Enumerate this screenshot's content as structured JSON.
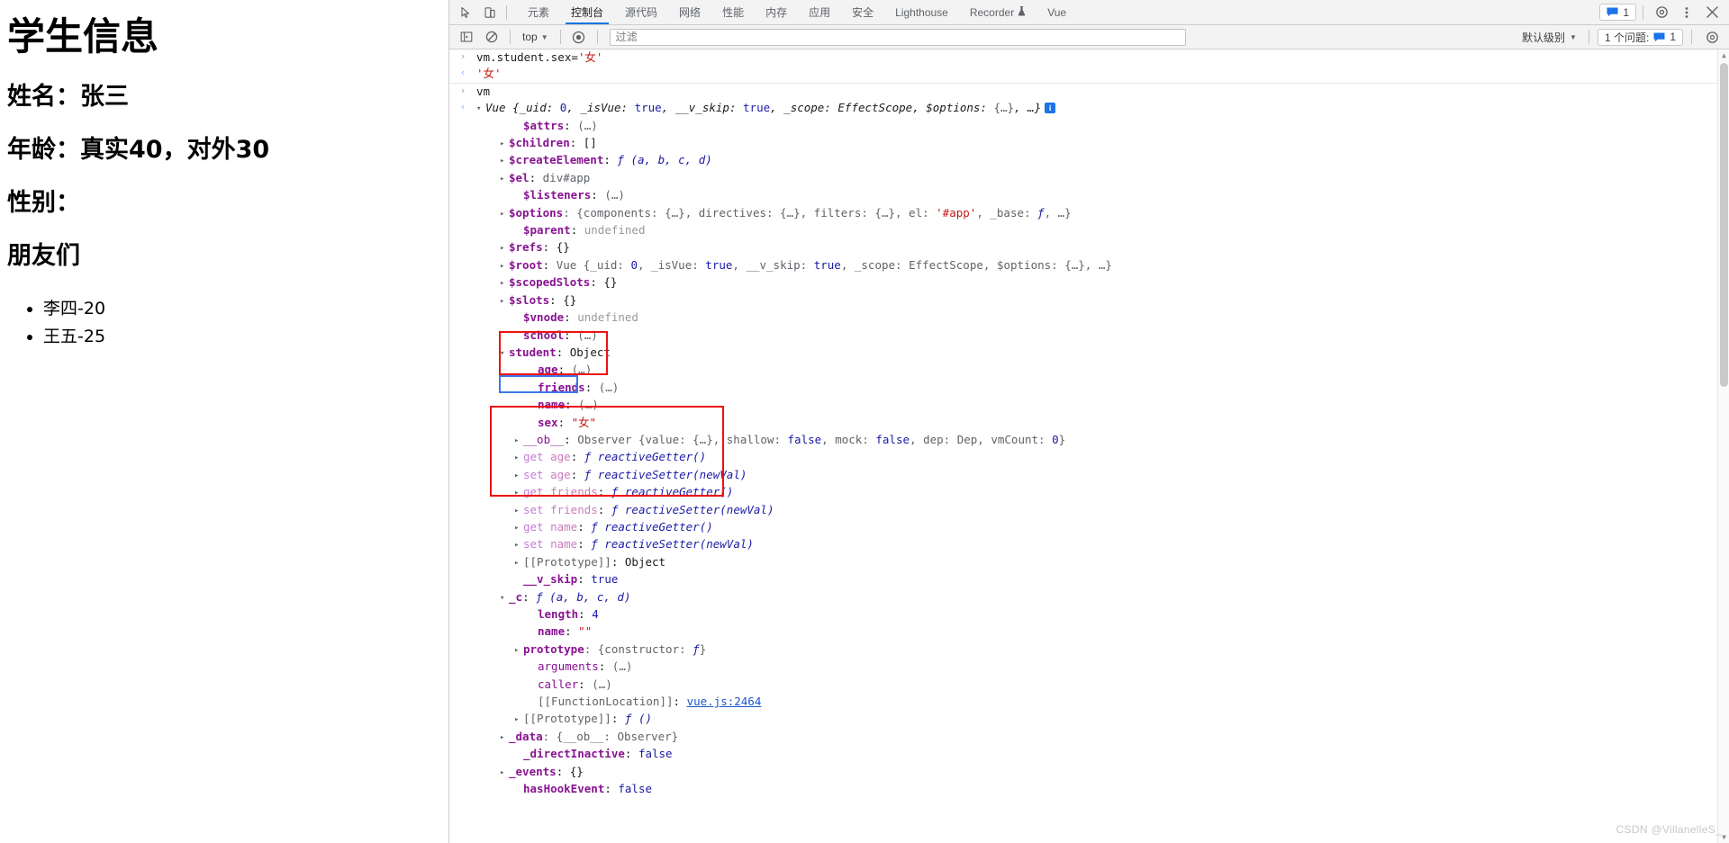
{
  "page": {
    "title": "学生信息",
    "name_line": "姓名：张三",
    "age_line": "年龄：真实40，对外30",
    "sex_line": "性别：",
    "friends_title": "朋友们",
    "friends": [
      "李四-20",
      "王五-25"
    ]
  },
  "devtools": {
    "tabs": [
      {
        "label": "元素",
        "active": false,
        "icon": ""
      },
      {
        "label": "控制台",
        "active": true,
        "icon": ""
      },
      {
        "label": "源代码",
        "active": false,
        "icon": ""
      },
      {
        "label": "网络",
        "active": false,
        "icon": ""
      },
      {
        "label": "性能",
        "active": false,
        "icon": ""
      },
      {
        "label": "内存",
        "active": false,
        "icon": ""
      },
      {
        "label": "应用",
        "active": false,
        "icon": ""
      },
      {
        "label": "安全",
        "active": false,
        "icon": ""
      },
      {
        "label": "Lighthouse",
        "active": false,
        "icon": ""
      },
      {
        "label": "Recorder",
        "active": false,
        "icon": "flask-icon"
      },
      {
        "label": "Vue",
        "active": false,
        "icon": ""
      }
    ],
    "top_right": {
      "messages_count": "1",
      "settings_icon": "gear-icon",
      "more_icon": "kebab-menu-icon",
      "close_icon": "close-icon",
      "inspect_icon": "inspect-element-icon",
      "device_icon": "device-toolbar-icon"
    },
    "console_toolbar": {
      "execute_icon": "sidebar-toggle-icon",
      "clear_icon": "clear-console-icon",
      "context": "top",
      "eye_icon": "live-expression-icon",
      "filter_placeholder": "过滤",
      "filter_value": "",
      "level": "默认级别",
      "issues_label": "1 个问题:",
      "issues_count": "1",
      "settings_icon": "gear-icon"
    }
  },
  "console": {
    "entries": [
      {
        "kind": "input",
        "gutter": "›",
        "indent": 0,
        "segs": [
          {
            "t": "vm.student.sex=",
            "c": "v-obj"
          },
          {
            "t": "'女'",
            "c": "v-str"
          }
        ]
      },
      {
        "kind": "output",
        "gutter": "‹",
        "indent": 0,
        "border": true,
        "segs": [
          {
            "t": "'女'",
            "c": "v-str"
          }
        ]
      },
      {
        "kind": "input",
        "gutter": "›",
        "indent": 0,
        "segs": [
          {
            "t": "vm",
            "c": "v-obj"
          }
        ]
      },
      {
        "kind": "output",
        "gutter": "‹",
        "indent": 0,
        "tri": "▾",
        "segs": [
          {
            "t": "Vue ",
            "c": "v-class"
          },
          {
            "t": "{_uid: ",
            "c": "v-class"
          },
          {
            "t": "0",
            "c": "v-num"
          },
          {
            "t": ", _isVue: ",
            "c": "v-class"
          },
          {
            "t": "true",
            "c": "v-bool"
          },
          {
            "t": ", __v_skip: ",
            "c": "v-class"
          },
          {
            "t": "true",
            "c": "v-bool"
          },
          {
            "t": ", _scope: ",
            "c": "v-class"
          },
          {
            "t": "EffectScope",
            "c": "v-class"
          },
          {
            "t": ", $options: ",
            "c": "v-class"
          },
          {
            "t": "{…}",
            "c": "v-dim"
          },
          {
            "t": ", …}",
            "c": "v-class"
          },
          {
            "t": "INFO",
            "c": "info"
          }
        ]
      },
      {
        "indent": 3,
        "tri": " ",
        "segs": [
          {
            "t": "$attrs",
            "c": "k-name"
          },
          {
            "t": ": ",
            "c": "v-obj"
          },
          {
            "t": "(…)",
            "c": "ellip"
          }
        ]
      },
      {
        "indent": 2,
        "tri": "▸",
        "segs": [
          {
            "t": "$children",
            "c": "k-name"
          },
          {
            "t": ": []",
            "c": "v-obj"
          }
        ]
      },
      {
        "indent": 2,
        "tri": "▸",
        "segs": [
          {
            "t": "$createElement",
            "c": "k-name"
          },
          {
            "t": ": ",
            "c": "v-obj"
          },
          {
            "t": "ƒ (a, b, c, d)",
            "c": "v-fn"
          }
        ]
      },
      {
        "indent": 2,
        "tri": "▸",
        "segs": [
          {
            "t": "$el",
            "c": "k-name"
          },
          {
            "t": ": ",
            "c": "v-obj"
          },
          {
            "t": "div#app",
            "c": "v-dim"
          }
        ]
      },
      {
        "indent": 3,
        "tri": " ",
        "segs": [
          {
            "t": "$listeners",
            "c": "k-name"
          },
          {
            "t": ": ",
            "c": "v-obj"
          },
          {
            "t": "(…)",
            "c": "ellip"
          }
        ]
      },
      {
        "indent": 2,
        "tri": "▸",
        "segs": [
          {
            "t": "$options",
            "c": "k-name"
          },
          {
            "t": ": {components: ",
            "c": "v-dim"
          },
          {
            "t": "{…}",
            "c": "v-dim"
          },
          {
            "t": ", directives: ",
            "c": "v-dim"
          },
          {
            "t": "{…}",
            "c": "v-dim"
          },
          {
            "t": ", filters: ",
            "c": "v-dim"
          },
          {
            "t": "{…}",
            "c": "v-dim"
          },
          {
            "t": ", el: ",
            "c": "v-dim"
          },
          {
            "t": "'#app'",
            "c": "v-str"
          },
          {
            "t": ", _base: ",
            "c": "v-dim"
          },
          {
            "t": "ƒ",
            "c": "v-fn"
          },
          {
            "t": ", …}",
            "c": "v-dim"
          }
        ]
      },
      {
        "indent": 3,
        "tri": " ",
        "segs": [
          {
            "t": "$parent",
            "c": "k-name"
          },
          {
            "t": ": ",
            "c": "v-obj"
          },
          {
            "t": "undefined",
            "c": "v-undef"
          }
        ]
      },
      {
        "indent": 2,
        "tri": "▸",
        "segs": [
          {
            "t": "$refs",
            "c": "k-name"
          },
          {
            "t": ": {}",
            "c": "v-obj"
          }
        ]
      },
      {
        "indent": 2,
        "tri": "▸",
        "segs": [
          {
            "t": "$root",
            "c": "k-name"
          },
          {
            "t": ": ",
            "c": "v-obj"
          },
          {
            "t": "Vue {_uid: ",
            "c": "v-dim"
          },
          {
            "t": "0",
            "c": "v-num"
          },
          {
            "t": ", _isVue: ",
            "c": "v-dim"
          },
          {
            "t": "true",
            "c": "v-bool"
          },
          {
            "t": ", __v_skip: ",
            "c": "v-dim"
          },
          {
            "t": "true",
            "c": "v-bool"
          },
          {
            "t": ", _scope: ",
            "c": "v-dim"
          },
          {
            "t": "EffectScope",
            "c": "v-dim"
          },
          {
            "t": ", $options: ",
            "c": "v-dim"
          },
          {
            "t": "{…}",
            "c": "v-dim"
          },
          {
            "t": ", …}",
            "c": "v-dim"
          }
        ]
      },
      {
        "indent": 2,
        "tri": "▸",
        "segs": [
          {
            "t": "$scopedSlots",
            "c": "k-name"
          },
          {
            "t": ": {}",
            "c": "v-obj"
          }
        ]
      },
      {
        "indent": 2,
        "tri": "▸",
        "segs": [
          {
            "t": "$slots",
            "c": "k-name"
          },
          {
            "t": ": {}",
            "c": "v-obj"
          }
        ]
      },
      {
        "indent": 3,
        "tri": " ",
        "segs": [
          {
            "t": "$vnode",
            "c": "k-name"
          },
          {
            "t": ": ",
            "c": "v-obj"
          },
          {
            "t": "undefined",
            "c": "v-undef"
          }
        ]
      },
      {
        "indent": 3,
        "tri": " ",
        "segs": [
          {
            "t": "school",
            "c": "k-name"
          },
          {
            "t": ": ",
            "c": "v-obj"
          },
          {
            "t": "(…)",
            "c": "ellip"
          }
        ]
      },
      {
        "indent": 2,
        "tri": "▾",
        "segs": [
          {
            "t": "student",
            "c": "k-name"
          },
          {
            "t": ": ",
            "c": "v-obj"
          },
          {
            "t": "Object",
            "c": "v-obj"
          }
        ]
      },
      {
        "indent": 4,
        "tri": " ",
        "segs": [
          {
            "t": "age",
            "c": "k-name"
          },
          {
            "t": ": ",
            "c": "v-obj"
          },
          {
            "t": "(…)",
            "c": "ellip"
          }
        ]
      },
      {
        "indent": 4,
        "tri": " ",
        "segs": [
          {
            "t": "friends",
            "c": "k-name"
          },
          {
            "t": ": ",
            "c": "v-obj"
          },
          {
            "t": "(…)",
            "c": "ellip"
          }
        ]
      },
      {
        "indent": 4,
        "tri": " ",
        "segs": [
          {
            "t": "name",
            "c": "k-name"
          },
          {
            "t": ": ",
            "c": "v-obj"
          },
          {
            "t": "(…)",
            "c": "ellip"
          }
        ]
      },
      {
        "indent": 4,
        "tri": " ",
        "segs": [
          {
            "t": "sex",
            "c": "k-name"
          },
          {
            "t": ": ",
            "c": "v-obj"
          },
          {
            "t": "\"女\"",
            "c": "v-str"
          }
        ]
      },
      {
        "indent": 3,
        "tri": "▸",
        "segs": [
          {
            "t": "__ob__",
            "c": "k-name2"
          },
          {
            "t": ": ",
            "c": "v-obj"
          },
          {
            "t": "Observer {value: ",
            "c": "v-dim"
          },
          {
            "t": "{…}",
            "c": "v-dim"
          },
          {
            "t": ", shallow: ",
            "c": "v-dim"
          },
          {
            "t": "false",
            "c": "v-bool"
          },
          {
            "t": ", mock: ",
            "c": "v-dim"
          },
          {
            "t": "false",
            "c": "v-bool"
          },
          {
            "t": ", dep: ",
            "c": "v-dim"
          },
          {
            "t": "Dep",
            "c": "v-dim"
          },
          {
            "t": ", vmCount: ",
            "c": "v-dim"
          },
          {
            "t": "0",
            "c": "v-num"
          },
          {
            "t": "}",
            "c": "v-dim"
          }
        ]
      },
      {
        "indent": 3,
        "tri": "▸",
        "segs": [
          {
            "t": "get ",
            "c": "k-gs"
          },
          {
            "t": "age",
            "c": "k-acc"
          },
          {
            "t": ": ",
            "c": "v-obj"
          },
          {
            "t": "ƒ reactiveGetter()",
            "c": "v-fn"
          }
        ]
      },
      {
        "indent": 3,
        "tri": "▸",
        "segs": [
          {
            "t": "set ",
            "c": "k-gs"
          },
          {
            "t": "age",
            "c": "k-acc"
          },
          {
            "t": ": ",
            "c": "v-obj"
          },
          {
            "t": "ƒ reactiveSetter(newVal)",
            "c": "v-fn"
          }
        ]
      },
      {
        "indent": 3,
        "tri": "▸",
        "segs": [
          {
            "t": "get ",
            "c": "k-gs"
          },
          {
            "t": "friends",
            "c": "k-acc"
          },
          {
            "t": ": ",
            "c": "v-obj"
          },
          {
            "t": "ƒ reactiveGetter()",
            "c": "v-fn"
          }
        ]
      },
      {
        "indent": 3,
        "tri": "▸",
        "segs": [
          {
            "t": "set ",
            "c": "k-gs"
          },
          {
            "t": "friends",
            "c": "k-acc"
          },
          {
            "t": ": ",
            "c": "v-obj"
          },
          {
            "t": "ƒ reactiveSetter(newVal)",
            "c": "v-fn"
          }
        ]
      },
      {
        "indent": 3,
        "tri": "▸",
        "segs": [
          {
            "t": "get ",
            "c": "k-gs"
          },
          {
            "t": "name",
            "c": "k-acc"
          },
          {
            "t": ": ",
            "c": "v-obj"
          },
          {
            "t": "ƒ reactiveGetter()",
            "c": "v-fn"
          }
        ]
      },
      {
        "indent": 3,
        "tri": "▸",
        "segs": [
          {
            "t": "set ",
            "c": "k-gs"
          },
          {
            "t": "name",
            "c": "k-acc"
          },
          {
            "t": ": ",
            "c": "v-obj"
          },
          {
            "t": "ƒ reactiveSetter(newVal)",
            "c": "v-fn"
          }
        ]
      },
      {
        "indent": 3,
        "tri": "▸",
        "segs": [
          {
            "t": "[[Prototype]]",
            "c": "v-dim"
          },
          {
            "t": ": ",
            "c": "v-obj"
          },
          {
            "t": "Object",
            "c": "v-obj"
          }
        ]
      },
      {
        "indent": 3,
        "tri": " ",
        "segs": [
          {
            "t": "__v_skip",
            "c": "k-name"
          },
          {
            "t": ": ",
            "c": "v-obj"
          },
          {
            "t": "true",
            "c": "v-bool"
          }
        ]
      },
      {
        "indent": 2,
        "tri": "▾",
        "segs": [
          {
            "t": "_c",
            "c": "k-name"
          },
          {
            "t": ": ",
            "c": "v-obj"
          },
          {
            "t": "ƒ (a, b, c, d)",
            "c": "v-fn"
          }
        ]
      },
      {
        "indent": 4,
        "tri": " ",
        "segs": [
          {
            "t": "length",
            "c": "k-name"
          },
          {
            "t": ": ",
            "c": "v-obj"
          },
          {
            "t": "4",
            "c": "v-num"
          }
        ]
      },
      {
        "indent": 4,
        "tri": " ",
        "segs": [
          {
            "t": "name",
            "c": "k-name"
          },
          {
            "t": ": ",
            "c": "v-obj"
          },
          {
            "t": "\"\"",
            "c": "v-str"
          }
        ]
      },
      {
        "indent": 3,
        "tri": "▸",
        "segs": [
          {
            "t": "prototype",
            "c": "k-name"
          },
          {
            "t": ": {constructor: ",
            "c": "v-dim"
          },
          {
            "t": "ƒ",
            "c": "v-fn"
          },
          {
            "t": "}",
            "c": "v-dim"
          }
        ]
      },
      {
        "indent": 4,
        "tri": " ",
        "segs": [
          {
            "t": "arguments",
            "c": "k-name2"
          },
          {
            "t": ": ",
            "c": "v-obj"
          },
          {
            "t": "(…)",
            "c": "ellip"
          }
        ]
      },
      {
        "indent": 4,
        "tri": " ",
        "segs": [
          {
            "t": "caller",
            "c": "k-name2"
          },
          {
            "t": ": ",
            "c": "v-obj"
          },
          {
            "t": "(…)",
            "c": "ellip"
          }
        ]
      },
      {
        "indent": 4,
        "tri": " ",
        "segs": [
          {
            "t": "[[FunctionLocation]]",
            "c": "v-dim"
          },
          {
            "t": ": ",
            "c": "v-obj"
          },
          {
            "t": "vue.js:2464",
            "c": "lnk"
          }
        ]
      },
      {
        "indent": 3,
        "tri": "▸",
        "segs": [
          {
            "t": "[[Prototype]]",
            "c": "v-dim"
          },
          {
            "t": ": ",
            "c": "v-obj"
          },
          {
            "t": "ƒ ()",
            "c": "v-fn"
          }
        ]
      },
      {
        "indent": 2,
        "tri": "▸",
        "segs": [
          {
            "t": "_data",
            "c": "k-name"
          },
          {
            "t": ": {__ob__: ",
            "c": "v-dim"
          },
          {
            "t": "Observer",
            "c": "v-dim"
          },
          {
            "t": "}",
            "c": "v-dim"
          }
        ]
      },
      {
        "indent": 3,
        "tri": " ",
        "segs": [
          {
            "t": "_directInactive",
            "c": "k-name"
          },
          {
            "t": ": ",
            "c": "v-obj"
          },
          {
            "t": "false",
            "c": "v-bool"
          }
        ]
      },
      {
        "indent": 2,
        "tri": "▸",
        "segs": [
          {
            "t": "_events",
            "c": "k-name"
          },
          {
            "t": ": {}",
            "c": "v-obj"
          }
        ]
      },
      {
        "indent": 3,
        "tri": " ",
        "segs": [
          {
            "t": "hasHookEvent",
            "c": "k-name"
          },
          {
            "t": ": ",
            "c": "v-obj"
          },
          {
            "t": "false",
            "c": "v-bool"
          }
        ]
      }
    ]
  },
  "watermark": "CSDN @VillanelleS_",
  "colors": {
    "accent": "#1a73e8",
    "highlight_red": "#ee1111",
    "highlight_blue": "#3b78e7",
    "string": "#c41a16",
    "number": "#1a1aa6",
    "property": "#881391"
  }
}
